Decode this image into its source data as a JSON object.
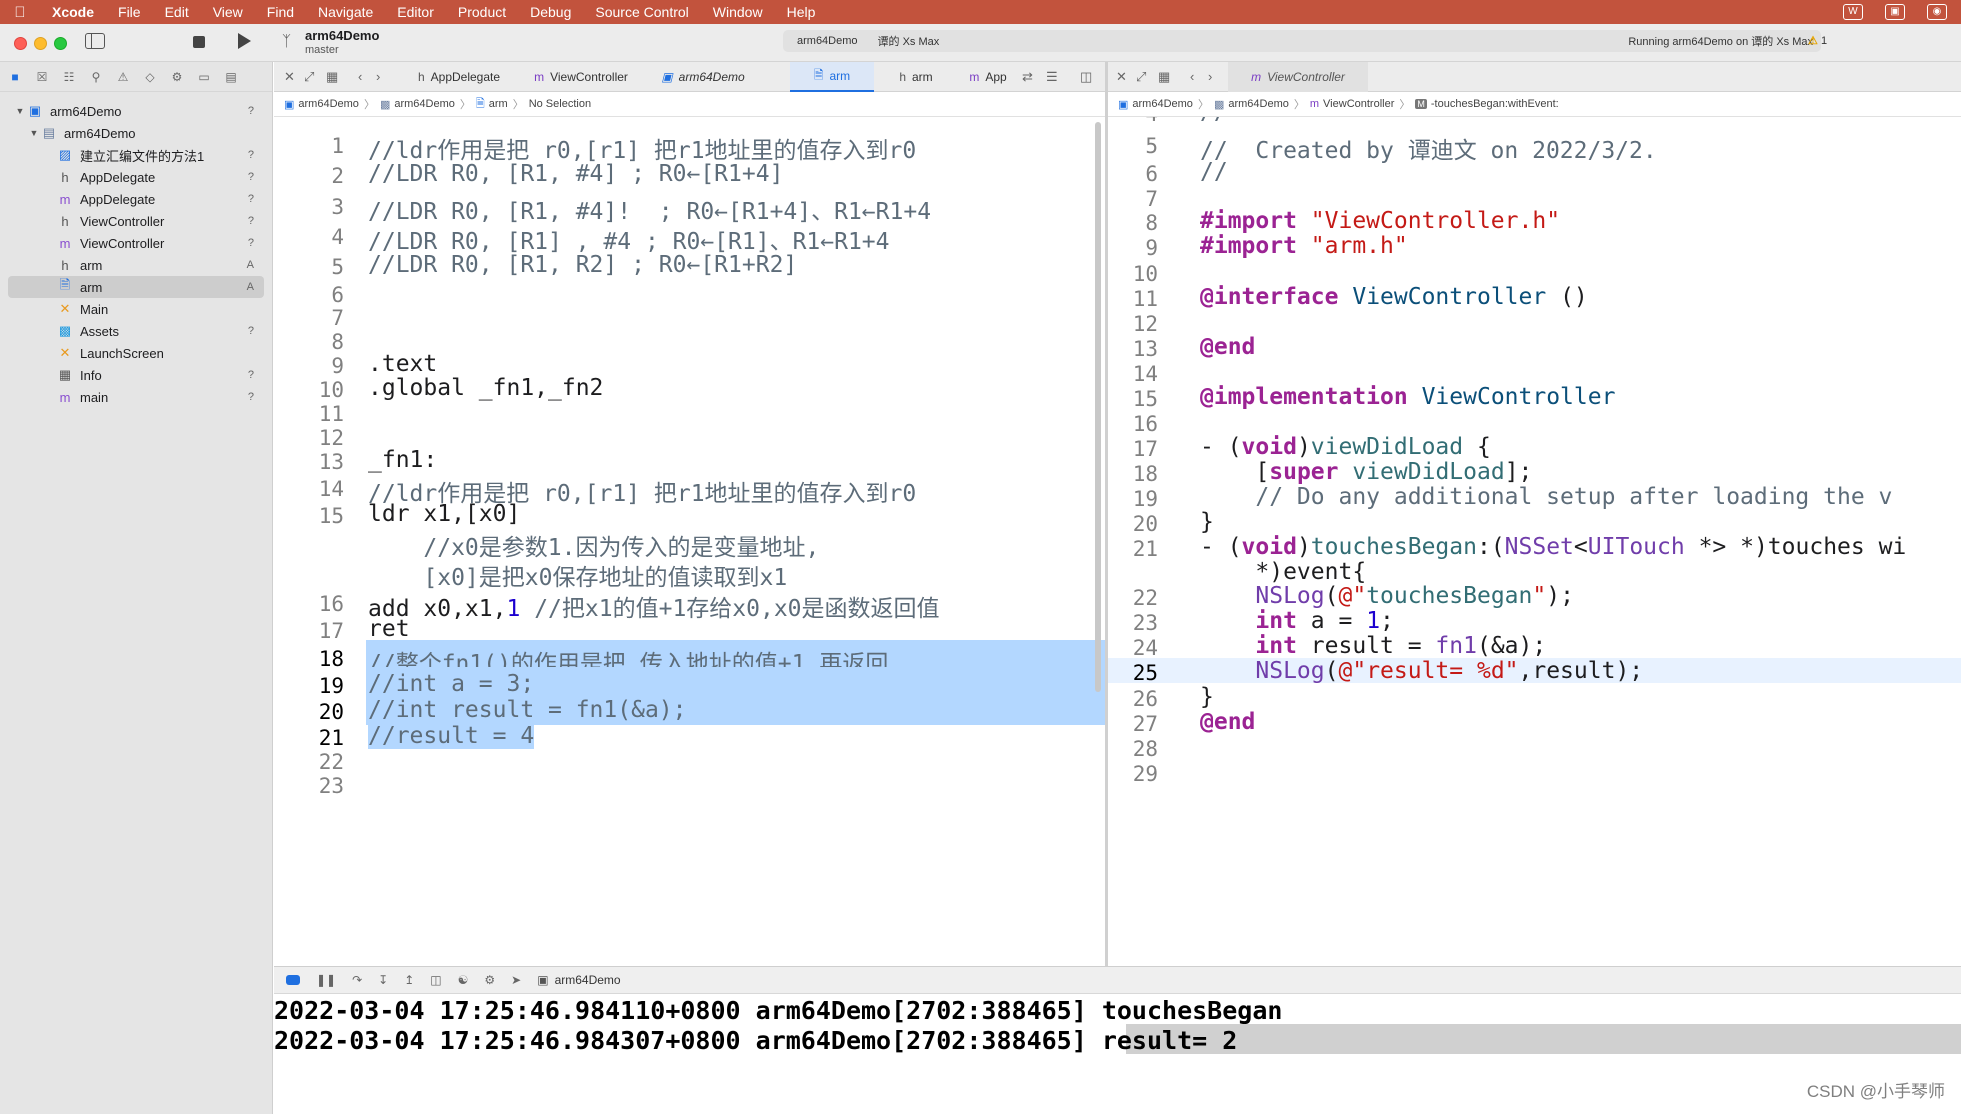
{
  "menubar": {
    "items": [
      "Xcode",
      "File",
      "Edit",
      "View",
      "Find",
      "Navigate",
      "Editor",
      "Product",
      "Debug",
      "Source Control",
      "Window",
      "Help"
    ]
  },
  "toolbar": {
    "project_name": "arm64Demo",
    "branch": "master",
    "scheme_target": "arm64Demo",
    "scheme_device": "谭的 Xs Max",
    "status": "Running arm64Demo on 谭的 Xs Max",
    "warning_count": "1"
  },
  "navigator": {
    "items": [
      {
        "label": "arm64Demo",
        "status": "?",
        "icon": "project-icon"
      },
      {
        "label": "arm64Demo",
        "status": "",
        "icon": "folder-icon"
      },
      {
        "label": "建立汇编文件的方法1",
        "status": "?",
        "icon": "image-file-icon"
      },
      {
        "label": "AppDelegate",
        "status": "?",
        "icon": "header-file-icon"
      },
      {
        "label": "AppDelegate",
        "status": "?",
        "icon": "objc-file-icon"
      },
      {
        "label": "ViewController",
        "status": "?",
        "icon": "header-file-icon"
      },
      {
        "label": "ViewController",
        "status": "?",
        "icon": "objc-file-icon"
      },
      {
        "label": "arm",
        "status": "A",
        "icon": "header-file-icon"
      },
      {
        "label": "arm",
        "status": "A",
        "icon": "asm-file-icon"
      },
      {
        "label": "Main",
        "status": "",
        "icon": "storyboard-icon"
      },
      {
        "label": "Assets",
        "status": "?",
        "icon": "assets-icon"
      },
      {
        "label": "LaunchScreen",
        "status": "",
        "icon": "storyboard-icon"
      },
      {
        "label": "Info",
        "status": "?",
        "icon": "plist-icon"
      },
      {
        "label": "main",
        "status": "?",
        "icon": "objc-file-icon"
      }
    ]
  },
  "left_tabs": [
    "AppDelegate",
    "ViewController",
    "arm64Demo",
    "arm",
    "arm",
    "App"
  ],
  "left_jumpbar": [
    "arm64Demo",
    "arm64Demo",
    "arm",
    "No Selection"
  ],
  "right_tabs": [
    "ViewController"
  ],
  "right_jumpbar": [
    "arm64Demo",
    "arm64Demo",
    "ViewController",
    "-touchesBegan:withEvent:"
  ],
  "left_editor": {
    "lines": [
      {
        "n": "1",
        "t": "//ldr作用是把 r0,[r1] 把r1地址里的值存入到r0"
      },
      {
        "n": "2",
        "t": "//LDR R0, [R1, #4] ; R0←[R1+4]"
      },
      {
        "n": "3",
        "t": "//LDR R0, [R1, #4]!  ; R0←[R1+4]、R1←R1+4"
      },
      {
        "n": "4",
        "t": "//LDR R0, [R1] , #4 ; R0←[R1]、R1←R1+4"
      },
      {
        "n": "5",
        "t": "//LDR R0, [R1, R2] ; R0←[R1+R2]"
      },
      {
        "n": "6",
        "t": ""
      },
      {
        "n": "7",
        "t": ""
      },
      {
        "n": "8",
        "t": ""
      },
      {
        "n": "9",
        "t": ".text"
      },
      {
        "n": "10",
        "t": ".global _fn1,_fn2"
      },
      {
        "n": "11",
        "t": ""
      },
      {
        "n": "12",
        "t": ""
      },
      {
        "n": "13",
        "t": "_fn1:"
      },
      {
        "n": "14",
        "t": "//ldr作用是把 r0,[r1] 把r1地址里的值存入到r0"
      },
      {
        "n": "15",
        "t": "ldr x1,[x0]"
      },
      {
        "n": "",
        "t": "    //x0是参数1.因为传入的是变量地址,"
      },
      {
        "n": "",
        "t": "    [x0]是把x0保存地址的值读取到x1"
      },
      {
        "n": "16",
        "t": "add x0,x1,1 //把x1的值+1存给x0,x0是函数返回值"
      },
      {
        "n": "17",
        "t": "ret"
      },
      {
        "n": "18",
        "t": "//整个fn1()的作用是把,传入地址的值+1,再返回"
      },
      {
        "n": "19",
        "t": "//int a = 3;"
      },
      {
        "n": "20",
        "t": "//int result = fn1(&a);"
      },
      {
        "n": "21",
        "t": "//result = 4"
      },
      {
        "n": "22",
        "t": ""
      },
      {
        "n": "23",
        "t": ""
      }
    ]
  },
  "right_editor": {
    "lines": [
      {
        "n": "4",
        "t": "//"
      },
      {
        "n": "5",
        "t": "//  Created by 谭迪文 on 2022/3/2."
      },
      {
        "n": "6",
        "t": "//"
      },
      {
        "n": "7",
        "t": ""
      },
      {
        "n": "8",
        "t": "#import \"ViewController.h\""
      },
      {
        "n": "9",
        "t": "#import \"arm.h\""
      },
      {
        "n": "10",
        "t": ""
      },
      {
        "n": "11",
        "t": "@interface ViewController ()"
      },
      {
        "n": "12",
        "t": ""
      },
      {
        "n": "13",
        "t": "@end"
      },
      {
        "n": "14",
        "t": ""
      },
      {
        "n": "15",
        "t": "@implementation ViewController"
      },
      {
        "n": "16",
        "t": ""
      },
      {
        "n": "17",
        "t": "- (void)viewDidLoad {"
      },
      {
        "n": "18",
        "t": "    [super viewDidLoad];"
      },
      {
        "n": "19",
        "t": "    // Do any additional setup after loading the v"
      },
      {
        "n": "20",
        "t": "}"
      },
      {
        "n": "21",
        "t": "- (void)touchesBegan:(NSSet<UITouch *> *)touches wi"
      },
      {
        "n": "",
        "t": "    *)event{"
      },
      {
        "n": "22",
        "t": "    NSLog(@\"touchesBegan\");"
      },
      {
        "n": "23",
        "t": "    int a = 1;"
      },
      {
        "n": "24",
        "t": "    int result = fn1(&a);"
      },
      {
        "n": "25",
        "t": "    NSLog(@\"result= %d\",result);"
      },
      {
        "n": "26",
        "t": "}"
      },
      {
        "n": "27",
        "t": "@end"
      },
      {
        "n": "28",
        "t": ""
      },
      {
        "n": "29",
        "t": ""
      }
    ]
  },
  "debug": {
    "target": "arm64Demo"
  },
  "console": {
    "lines": [
      {
        "prefix": "2022-03-04 17:25:46.984110+0800 arm64Demo[2702:388465] ",
        "msg": "touchesBegan"
      },
      {
        "prefix": "2022-03-04 17:25:46.984307+0800 arm64Demo[2702:388465] ",
        "msg": "result= 2"
      }
    ]
  },
  "watermark": "CSDN @小手琴师",
  "colors": {
    "menubar": "#c2533d",
    "accent": "#1f6fe0",
    "selection": "#b3d7ff",
    "comment": "#5d6c79",
    "keyword": "#9b2393",
    "string": "#c41a16"
  }
}
